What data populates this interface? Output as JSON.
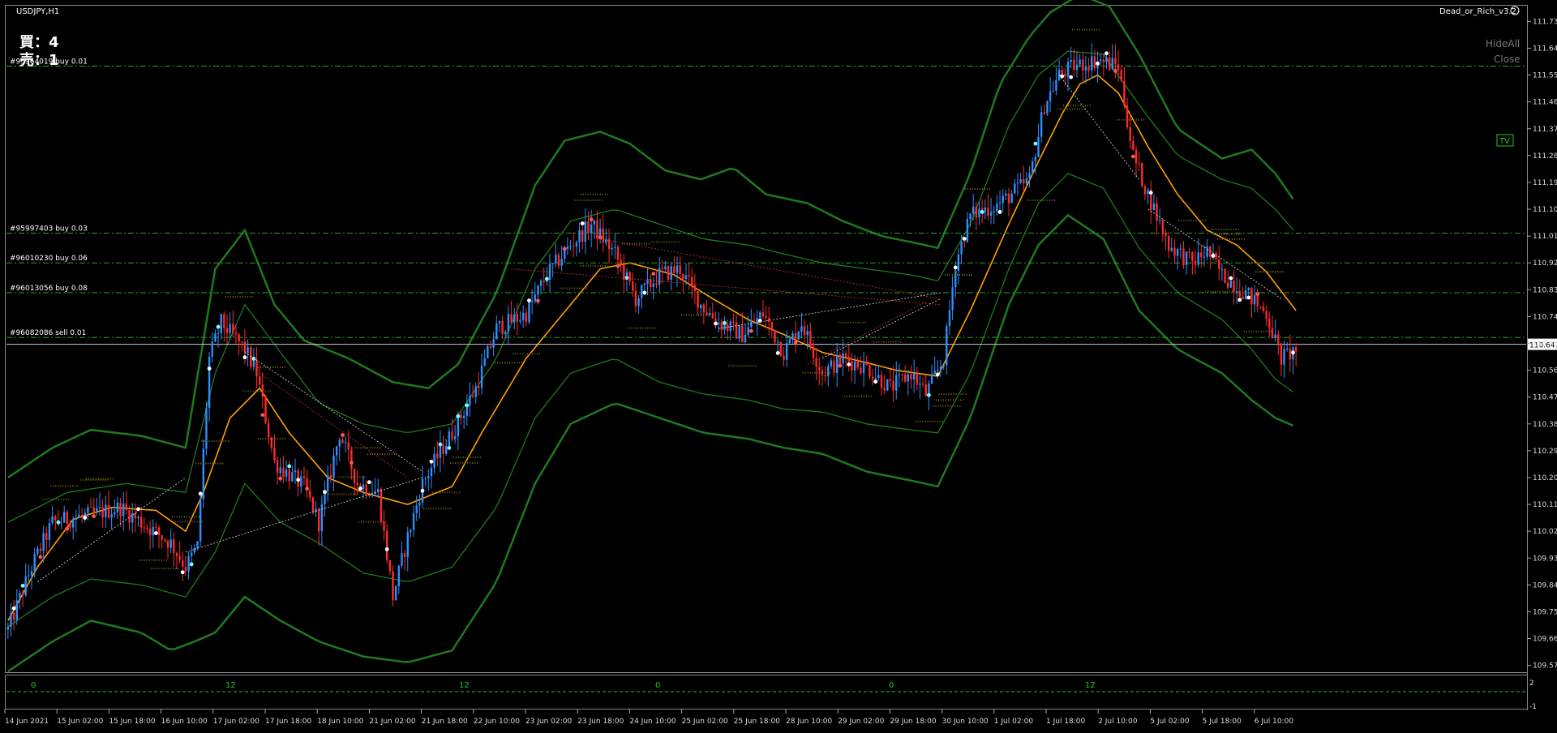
{
  "window": {
    "title": "USDJPY,H1",
    "indicator_name": "Dead_or_Rich_v3.2",
    "buttons": {
      "hide_all": "HideAll",
      "close": "Close",
      "tv": "TV"
    }
  },
  "positions_summary": {
    "buy_label": "買：4",
    "sell_label": "売：1"
  },
  "chart_data": {
    "type": "candlestick",
    "symbol": "USDJPY",
    "timeframe": "H1",
    "ylim": [
      109.55,
      111.78
    ],
    "price_ticks": [
      111.73,
      111.64,
      111.55,
      111.46,
      111.37,
      111.28,
      111.19,
      111.1,
      111.01,
      110.92,
      110.83,
      110.74,
      110.65,
      110.56,
      110.47,
      110.38,
      110.29,
      110.2,
      110.11,
      110.02,
      109.93,
      109.84,
      109.75,
      109.66,
      109.57
    ],
    "price_tick_labels": [
      "111.730",
      "111.640",
      "111.550",
      "111.460",
      "111.370",
      "111.280",
      "111.190",
      "111.100",
      "111.010",
      "110.920",
      "110.830",
      "110.740",
      "110.650",
      "110.560",
      "110.470",
      "110.380",
      "110.290",
      "110.200",
      "110.110",
      "110.020",
      "109.930",
      "109.840",
      "109.750",
      "109.660",
      "109.570"
    ],
    "current_price": 110.647,
    "current_price_label": "110.647",
    "time_labels": [
      "14 Jun 2021",
      "15 Jun 02:00",
      "15 Jun 18:00",
      "16 Jun 10:00",
      "17 Jun 02:00",
      "17 Jun 18:00",
      "18 Jun 10:00",
      "21 Jun 02:00",
      "21 Jun 18:00",
      "22 Jun 10:00",
      "23 Jun 02:00",
      "23 Jun 18:00",
      "24 Jun 10:00",
      "25 Jun 02:00",
      "25 Jun 18:00",
      "28 Jun 10:00",
      "29 Jun 02:00",
      "29 Jun 18:00",
      "30 Jun 10:00",
      "1 Jul 02:00",
      "1 Jul 18:00",
      "2 Jul 10:00",
      "5 Jul 02:00",
      "5 Jul 18:00",
      "6 Jul 10:00"
    ],
    "order_lines": [
      {
        "label": "#95964019 buy 0.01",
        "price": 111.58,
        "color": "#22aa22"
      },
      {
        "label": "#95997403 buy 0.03",
        "price": 111.02,
        "color": "#22aa22"
      },
      {
        "label": "#96010230 buy 0.06",
        "price": 110.92,
        "color": "#22aa22"
      },
      {
        "label": "#96013056 buy 0.08",
        "price": 110.82,
        "color": "#22aa22"
      },
      {
        "label": "#96082086 sell 0.01",
        "price": 110.67,
        "color": "#22aa22"
      }
    ],
    "close_path": [
      [
        0,
        109.69
      ],
      [
        8,
        109.9
      ],
      [
        15,
        110.05
      ],
      [
        30,
        110.08
      ],
      [
        38,
        110.1
      ],
      [
        45,
        110.05
      ],
      [
        55,
        109.98
      ],
      [
        60,
        109.9
      ],
      [
        64,
        109.97
      ],
      [
        68,
        110.6
      ],
      [
        72,
        110.72
      ],
      [
        80,
        110.63
      ],
      [
        84,
        110.55
      ],
      [
        90,
        110.25
      ],
      [
        100,
        110.17
      ],
      [
        105,
        110.05
      ],
      [
        112,
        110.35
      ],
      [
        118,
        110.18
      ],
      [
        125,
        110.15
      ],
      [
        130,
        109.8
      ],
      [
        135,
        110.0
      ],
      [
        140,
        110.18
      ],
      [
        145,
        110.27
      ],
      [
        150,
        110.35
      ],
      [
        158,
        110.5
      ],
      [
        165,
        110.7
      ],
      [
        175,
        110.75
      ],
      [
        182,
        110.88
      ],
      [
        190,
        110.98
      ],
      [
        197,
        111.05
      ],
      [
        205,
        110.95
      ],
      [
        212,
        110.8
      ],
      [
        220,
        110.88
      ],
      [
        227,
        110.9
      ],
      [
        234,
        110.78
      ],
      [
        240,
        110.72
      ],
      [
        248,
        110.68
      ],
      [
        255,
        110.75
      ],
      [
        262,
        110.62
      ],
      [
        268,
        110.72
      ],
      [
        275,
        110.55
      ],
      [
        282,
        110.6
      ],
      [
        290,
        110.57
      ],
      [
        298,
        110.5
      ],
      [
        305,
        110.55
      ],
      [
        310,
        110.48
      ],
      [
        316,
        110.6
      ],
      [
        320,
        110.92
      ],
      [
        325,
        111.08
      ],
      [
        335,
        111.12
      ],
      [
        345,
        111.2
      ],
      [
        350,
        111.45
      ],
      [
        355,
        111.55
      ],
      [
        360,
        111.58
      ],
      [
        368,
        111.6
      ],
      [
        375,
        111.58
      ],
      [
        380,
        111.28
      ],
      [
        385,
        111.15
      ],
      [
        392,
        110.98
      ],
      [
        400,
        110.92
      ],
      [
        405,
        110.96
      ],
      [
        410,
        110.88
      ],
      [
        418,
        110.82
      ],
      [
        425,
        110.75
      ],
      [
        430,
        110.6
      ],
      [
        435,
        110.63
      ]
    ],
    "ma_path": [
      [
        0,
        109.72
      ],
      [
        10,
        109.9
      ],
      [
        22,
        110.06
      ],
      [
        35,
        110.1
      ],
      [
        50,
        110.09
      ],
      [
        60,
        110.02
      ],
      [
        66,
        110.15
      ],
      [
        75,
        110.4
      ],
      [
        85,
        110.5
      ],
      [
        95,
        110.35
      ],
      [
        108,
        110.2
      ],
      [
        120,
        110.15
      ],
      [
        135,
        110.11
      ],
      [
        150,
        110.17
      ],
      [
        160,
        110.35
      ],
      [
        175,
        110.6
      ],
      [
        190,
        110.78
      ],
      [
        200,
        110.9
      ],
      [
        210,
        110.92
      ],
      [
        225,
        110.88
      ],
      [
        238,
        110.8
      ],
      [
        250,
        110.73
      ],
      [
        262,
        110.68
      ],
      [
        275,
        110.62
      ],
      [
        288,
        110.59
      ],
      [
        300,
        110.56
      ],
      [
        314,
        110.54
      ],
      [
        325,
        110.76
      ],
      [
        338,
        111.05
      ],
      [
        348,
        111.26
      ],
      [
        356,
        111.42
      ],
      [
        362,
        111.52
      ],
      [
        368,
        111.55
      ],
      [
        375,
        111.49
      ],
      [
        385,
        111.31
      ],
      [
        395,
        111.15
      ],
      [
        405,
        111.03
      ],
      [
        415,
        110.98
      ],
      [
        425,
        110.89
      ],
      [
        435,
        110.76
      ]
    ],
    "upper_band_path": [
      [
        0,
        110.2
      ],
      [
        15,
        110.3
      ],
      [
        28,
        110.36
      ],
      [
        45,
        110.34
      ],
      [
        60,
        110.3
      ],
      [
        70,
        110.9
      ],
      [
        80,
        111.03
      ],
      [
        90,
        110.78
      ],
      [
        100,
        110.66
      ],
      [
        115,
        110.6
      ],
      [
        130,
        110.52
      ],
      [
        142,
        110.5
      ],
      [
        152,
        110.58
      ],
      [
        165,
        110.82
      ],
      [
        178,
        111.18
      ],
      [
        188,
        111.33
      ],
      [
        200,
        111.36
      ],
      [
        210,
        111.32
      ],
      [
        222,
        111.23
      ],
      [
        234,
        111.2
      ],
      [
        245,
        111.24
      ],
      [
        256,
        111.15
      ],
      [
        270,
        111.12
      ],
      [
        282,
        111.06
      ],
      [
        295,
        111.01
      ],
      [
        305,
        110.99
      ],
      [
        314,
        110.97
      ],
      [
        325,
        111.22
      ],
      [
        335,
        111.52
      ],
      [
        345,
        111.68
      ],
      [
        352,
        111.76
      ],
      [
        362,
        111.82
      ],
      [
        372,
        111.78
      ],
      [
        382,
        111.62
      ],
      [
        395,
        111.37
      ],
      [
        410,
        111.27
      ],
      [
        420,
        111.3
      ],
      [
        428,
        111.22
      ],
      [
        435,
        111.12
      ]
    ],
    "inner_upper_path": [
      [
        0,
        110.05
      ],
      [
        20,
        110.15
      ],
      [
        40,
        110.18
      ],
      [
        60,
        110.15
      ],
      [
        70,
        110.55
      ],
      [
        80,
        110.78
      ],
      [
        92,
        110.62
      ],
      [
        105,
        110.45
      ],
      [
        120,
        110.38
      ],
      [
        135,
        110.35
      ],
      [
        150,
        110.38
      ],
      [
        165,
        110.6
      ],
      [
        178,
        110.9
      ],
      [
        190,
        111.06
      ],
      [
        205,
        111.1
      ],
      [
        220,
        111.05
      ],
      [
        235,
        111.0
      ],
      [
        250,
        110.98
      ],
      [
        262,
        110.95
      ],
      [
        275,
        110.92
      ],
      [
        290,
        110.9
      ],
      [
        305,
        110.88
      ],
      [
        314,
        110.86
      ],
      [
        325,
        111.05
      ],
      [
        338,
        111.38
      ],
      [
        348,
        111.55
      ],
      [
        358,
        111.63
      ],
      [
        370,
        111.62
      ],
      [
        382,
        111.45
      ],
      [
        395,
        111.28
      ],
      [
        410,
        111.2
      ],
      [
        420,
        111.17
      ],
      [
        428,
        111.1
      ],
      [
        435,
        111.02
      ]
    ],
    "inner_lower_path": [
      [
        0,
        109.7
      ],
      [
        15,
        109.8
      ],
      [
        28,
        109.86
      ],
      [
        45,
        109.84
      ],
      [
        60,
        109.8
      ],
      [
        70,
        109.95
      ],
      [
        80,
        110.18
      ],
      [
        92,
        110.05
      ],
      [
        105,
        109.98
      ],
      [
        120,
        109.88
      ],
      [
        135,
        109.85
      ],
      [
        150,
        109.9
      ],
      [
        165,
        110.1
      ],
      [
        178,
        110.4
      ],
      [
        190,
        110.55
      ],
      [
        205,
        110.6
      ],
      [
        220,
        110.52
      ],
      [
        235,
        110.48
      ],
      [
        250,
        110.46
      ],
      [
        262,
        110.43
      ],
      [
        275,
        110.42
      ],
      [
        290,
        110.38
      ],
      [
        305,
        110.36
      ],
      [
        314,
        110.35
      ],
      [
        325,
        110.55
      ],
      [
        338,
        110.9
      ],
      [
        348,
        111.12
      ],
      [
        358,
        111.22
      ],
      [
        370,
        111.17
      ],
      [
        382,
        110.97
      ],
      [
        395,
        110.82
      ],
      [
        410,
        110.73
      ],
      [
        420,
        110.63
      ],
      [
        428,
        110.53
      ],
      [
        435,
        110.48
      ]
    ],
    "lower_band_path": [
      [
        0,
        109.55
      ],
      [
        15,
        109.65
      ],
      [
        28,
        109.72
      ],
      [
        45,
        109.68
      ],
      [
        55,
        109.62
      ],
      [
        63,
        109.65
      ],
      [
        70,
        109.68
      ],
      [
        80,
        109.8
      ],
      [
        92,
        109.72
      ],
      [
        105,
        109.65
      ],
      [
        120,
        109.6
      ],
      [
        135,
        109.58
      ],
      [
        150,
        109.62
      ],
      [
        165,
        109.85
      ],
      [
        178,
        110.18
      ],
      [
        190,
        110.38
      ],
      [
        205,
        110.45
      ],
      [
        220,
        110.4
      ],
      [
        235,
        110.35
      ],
      [
        250,
        110.33
      ],
      [
        262,
        110.3
      ],
      [
        275,
        110.28
      ],
      [
        290,
        110.22
      ],
      [
        305,
        110.19
      ],
      [
        314,
        110.17
      ],
      [
        325,
        110.4
      ],
      [
        338,
        110.78
      ],
      [
        348,
        110.98
      ],
      [
        358,
        111.08
      ],
      [
        370,
        111.0
      ],
      [
        382,
        110.76
      ],
      [
        395,
        110.63
      ],
      [
        410,
        110.55
      ],
      [
        420,
        110.46
      ],
      [
        428,
        110.4
      ],
      [
        435,
        110.37
      ]
    ],
    "sub_window": {
      "labels": [
        "0",
        "12",
        "12",
        "0",
        "0",
        "12"
      ],
      "scale_top": "2",
      "scale_bottom": "-1"
    }
  }
}
